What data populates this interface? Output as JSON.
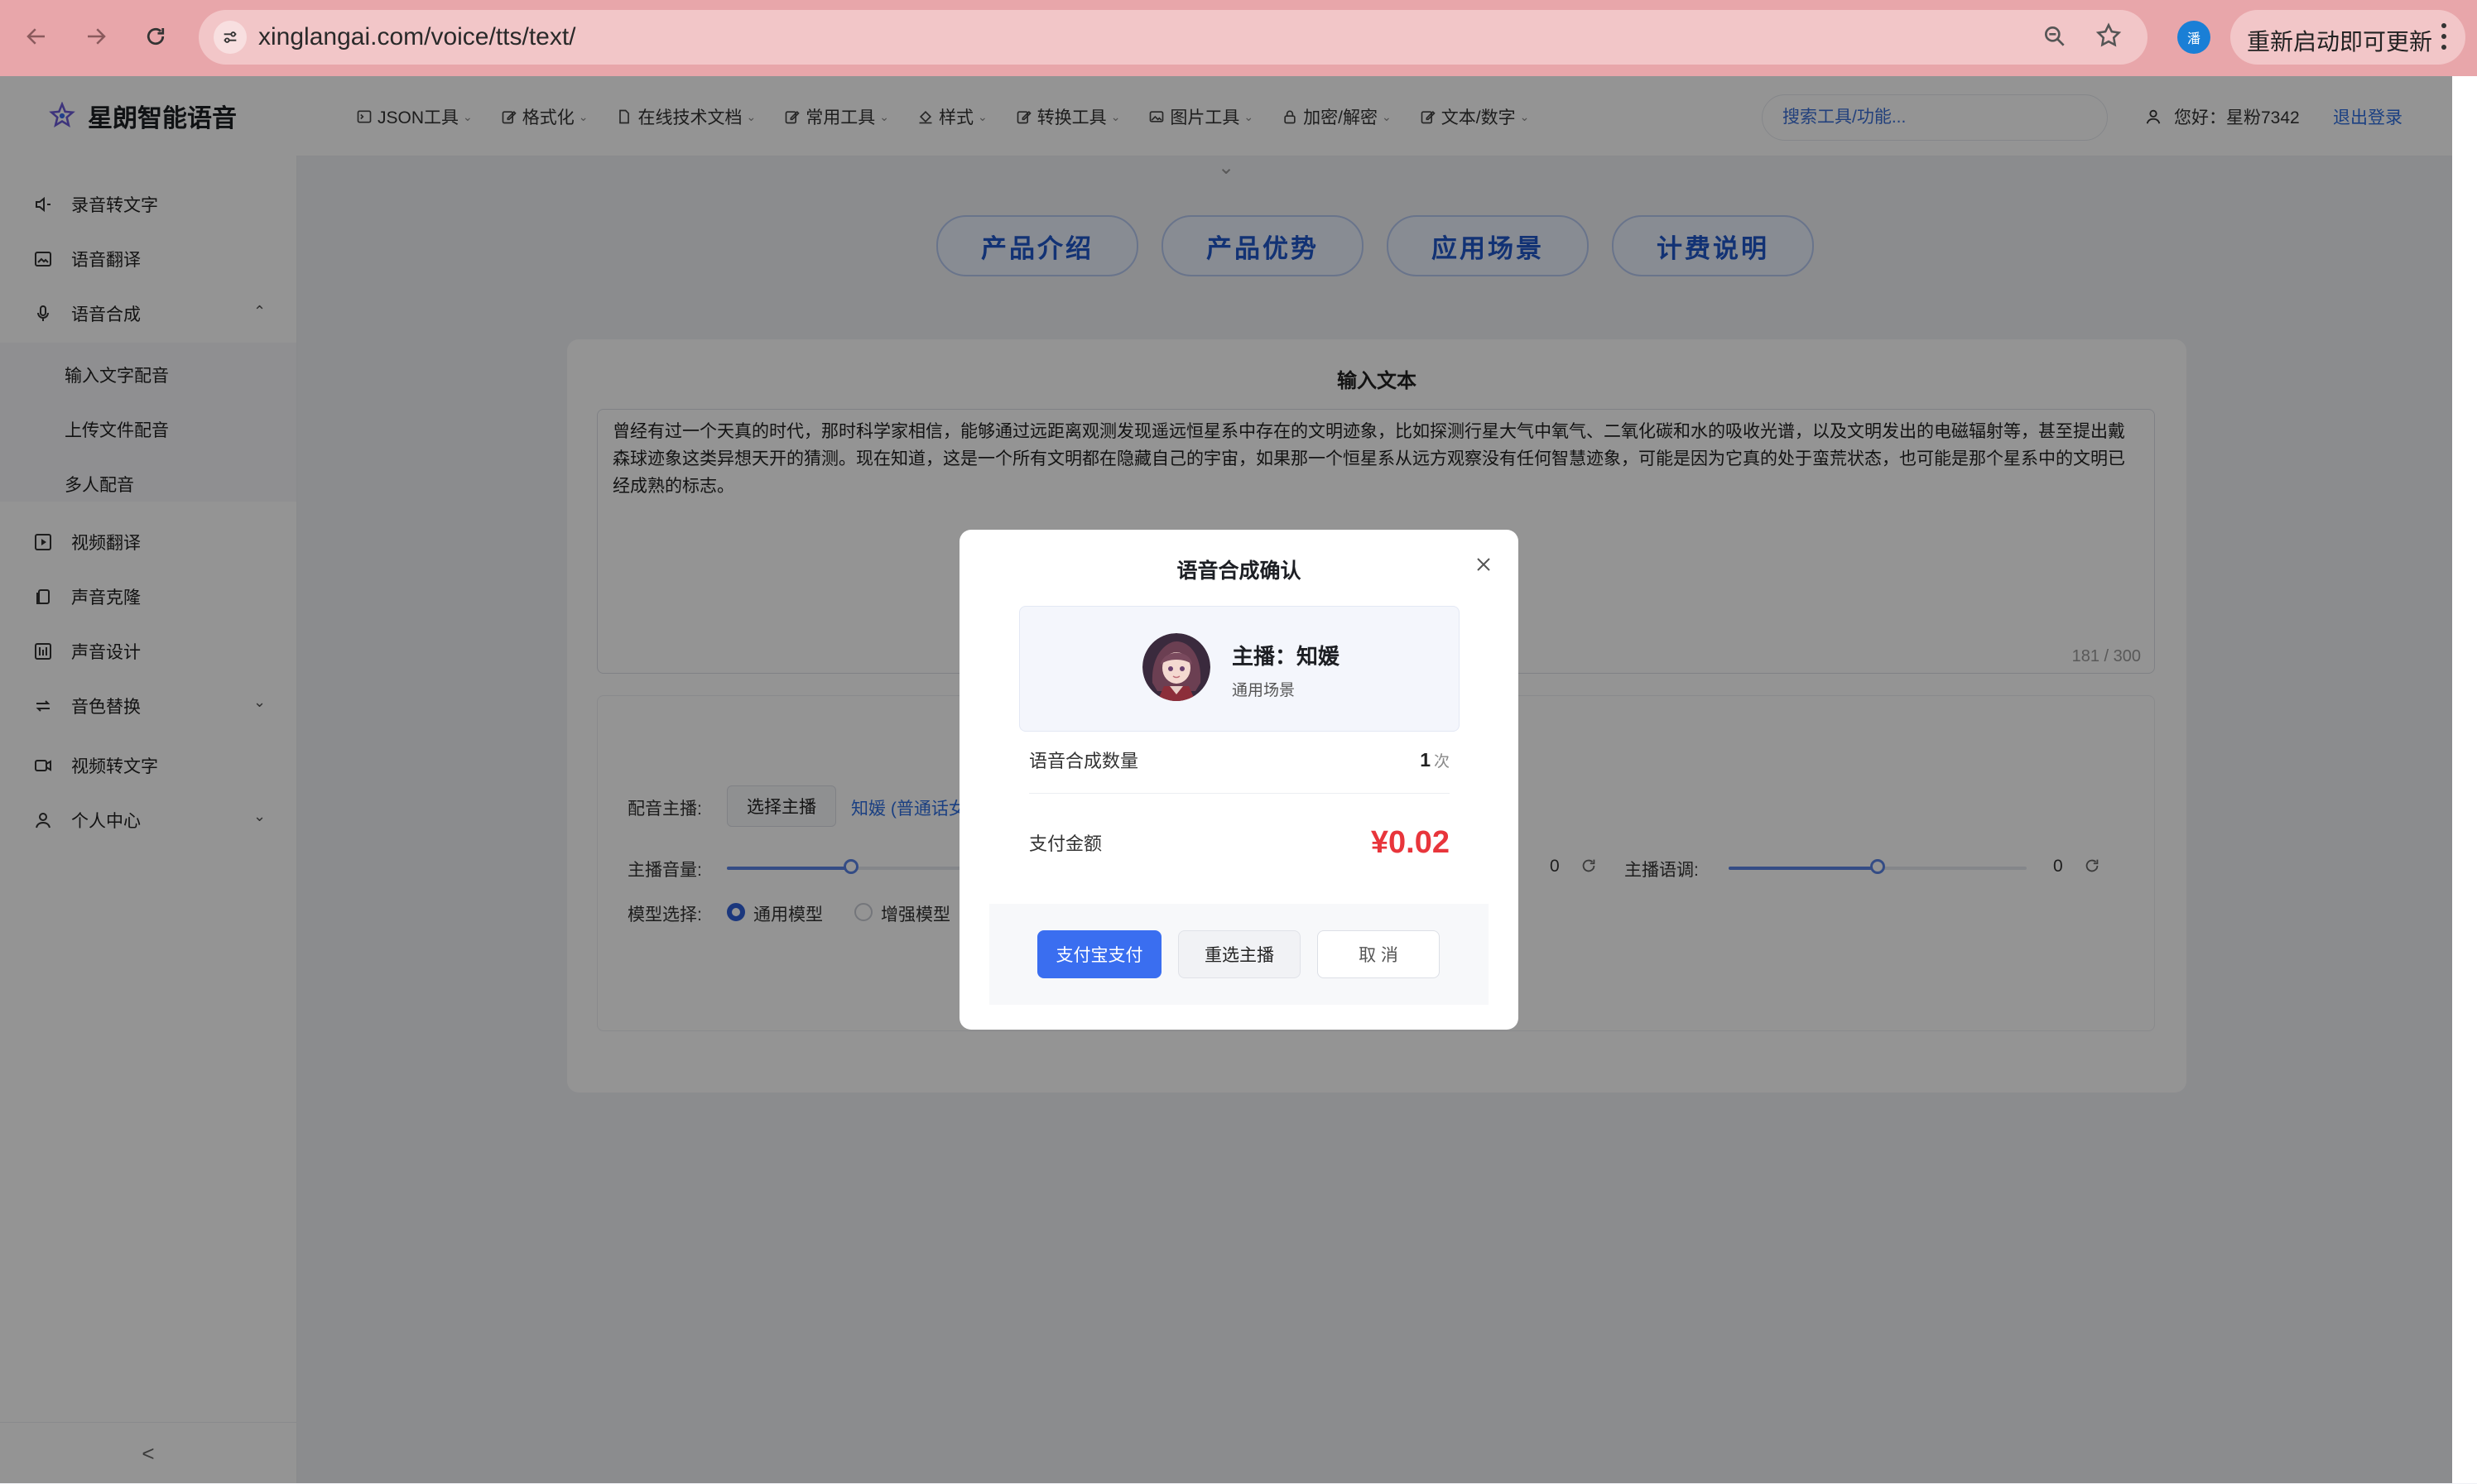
{
  "browser": {
    "url": "xinglangai.com/voice/tts/text/",
    "extension_label": "潘",
    "update_label": "重新启动即可更新"
  },
  "header": {
    "brand": "星朗智能语音",
    "nav": [
      {
        "label": "JSON工具"
      },
      {
        "label": "格式化"
      },
      {
        "label": "在线技术文档"
      },
      {
        "label": "常用工具"
      },
      {
        "label": "样式"
      },
      {
        "label": "转换工具"
      },
      {
        "label": "图片工具"
      },
      {
        "label": "加密/解密"
      },
      {
        "label": "文本/数字"
      }
    ],
    "search_placeholder": "搜索工具/功能...",
    "greeting": "您好：星粉7342",
    "logout": "退出登录"
  },
  "sidebar": {
    "items": [
      {
        "label": "录音转文字"
      },
      {
        "label": "语音翻译"
      },
      {
        "label": "语音合成"
      },
      {
        "label": "视频翻译"
      },
      {
        "label": "声音克隆"
      },
      {
        "label": "声音设计"
      },
      {
        "label": "音色替换"
      },
      {
        "label": "视频转文字"
      },
      {
        "label": "个人中心"
      }
    ],
    "sub_items": [
      {
        "label": "输入文字配音"
      },
      {
        "label": "上传文件配音"
      },
      {
        "label": "多人配音"
      }
    ],
    "collapse_glyph": "<"
  },
  "main": {
    "tabs": [
      {
        "label": "产品介绍"
      },
      {
        "label": "产品优势"
      },
      {
        "label": "应用场景"
      },
      {
        "label": "计费说明"
      }
    ],
    "card_title": "输入文本",
    "text_value": "曾经有过一个天真的时代，那时科学家相信，能够通过远距离观测发现遥远恒星系中存在的文明迹象，比如探测行星大气中氧气、二氧化碳和水的吸收光谱，以及文明发出的电磁辐射等，甚至提出戴森球迹象这类异想天开的猜测。现在知道，这是一个所有文明都在隐藏自己的宇宙，如果那一个恒星系从远方观察没有任何智慧迹象，可能是因为它真的处于蛮荒状态，也可能是那个星系中的文明已经成熟的标志。",
    "char_count": "181 / 300",
    "anchor_label": "配音主播:",
    "pick_anchor": "选择主播",
    "anchor_value": "知媛 (普通话女",
    "volume_label": "主播音量:",
    "volume_level": 0.5,
    "rate_value": "0",
    "pitch_label": "主播语调:",
    "pitch_level": 0.5,
    "pitch_value": "0",
    "model_label": "模型选择:",
    "model_options": [
      {
        "label": "通用模型",
        "selected": true
      },
      {
        "label": "增强模型",
        "selected": false
      }
    ]
  },
  "modal": {
    "title": "语音合成确认",
    "anchor_name": "主播：知媛",
    "anchor_scene": "通用场景",
    "qty_label": "语音合成数量",
    "qty_value": "1",
    "qty_unit": "次",
    "amount_label": "支付金额",
    "amount_value": "¥0.02",
    "pay_button": "支付宝支付",
    "reselect_button": "重选主播",
    "cancel_button": "取 消"
  }
}
